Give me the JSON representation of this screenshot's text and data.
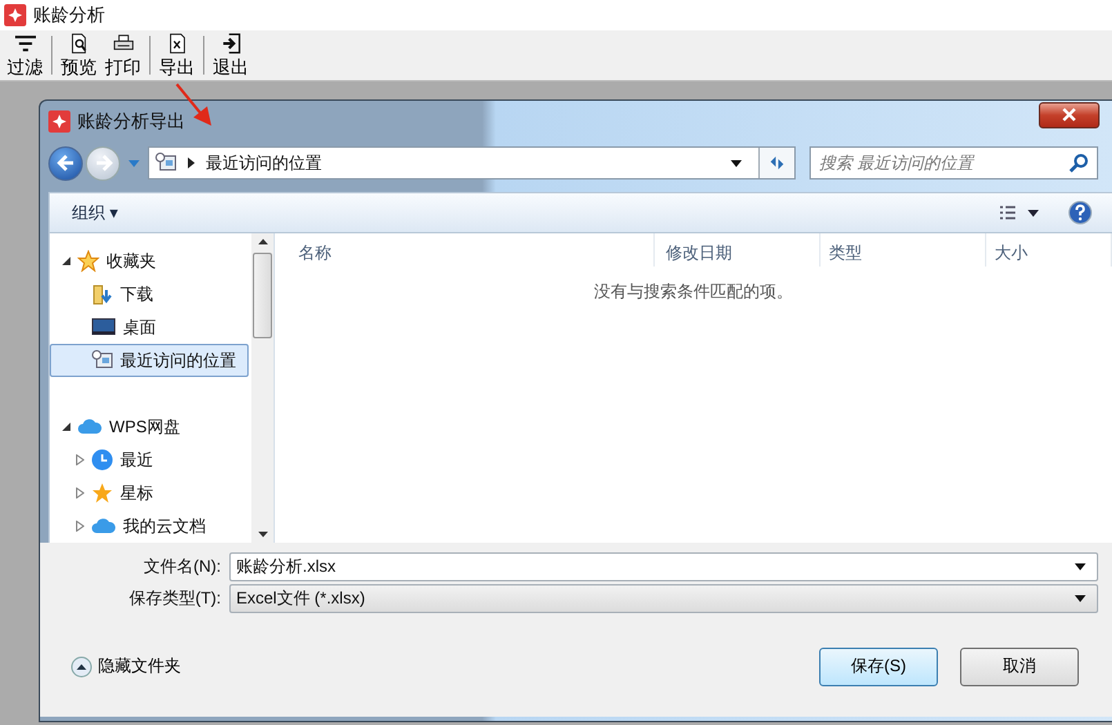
{
  "app": {
    "title": "账龄分析"
  },
  "toolbar": [
    {
      "kind": "filter",
      "label": "过滤"
    },
    {
      "kind": "sep"
    },
    {
      "kind": "preview",
      "label": "预览"
    },
    {
      "kind": "print",
      "label": "打印"
    },
    {
      "kind": "sep"
    },
    {
      "kind": "export",
      "label": "导出"
    },
    {
      "kind": "sep"
    },
    {
      "kind": "exit",
      "label": "退出"
    }
  ],
  "dialog": {
    "title": "账龄分析导出",
    "address": {
      "location": "最近访问的位置"
    },
    "search": {
      "placeholder": "搜索 最近访问的位置"
    },
    "organize": {
      "label": "组织 ▾"
    },
    "tree": [
      {
        "kind": "star",
        "label": "收藏夹",
        "expanded": true,
        "selected": false,
        "children": [
          {
            "kind": "download",
            "label": "下载",
            "selected": false
          },
          {
            "kind": "desktop",
            "label": "桌面",
            "selected": false
          },
          {
            "kind": "recent",
            "label": "最近访问的位置",
            "selected": true
          }
        ]
      },
      {
        "kind": "cloud",
        "label": "WPS网盘",
        "expanded": true,
        "selected": false,
        "children": [
          {
            "kind": "clock",
            "label": "最近",
            "expanded": false,
            "selected": false
          },
          {
            "kind": "star-solid",
            "label": "星标",
            "expanded": false,
            "selected": false
          },
          {
            "kind": "cloud",
            "label": "我的云文档",
            "expanded": false,
            "selected": false
          }
        ]
      }
    ],
    "columns": [
      "名称",
      "修改日期",
      "类型",
      "大小"
    ],
    "empty_message": "没有与搜索条件匹配的项。",
    "filename": {
      "label": "文件名(N):",
      "value": "账龄分析.xlsx"
    },
    "filetype": {
      "label": "保存类型(T):",
      "value": "Excel文件 (*.xlsx)"
    },
    "hide_folders": {
      "label": "隐藏文件夹"
    },
    "buttons": [
      {
        "label": "保存(S)",
        "primary": true
      },
      {
        "label": "取消",
        "primary": false
      }
    ]
  }
}
